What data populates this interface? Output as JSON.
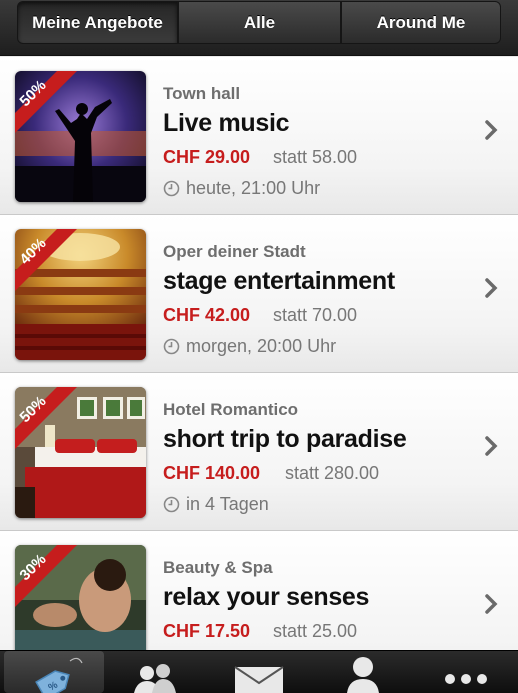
{
  "segments": [
    {
      "label": "Meine Angebote",
      "active": true
    },
    {
      "label": "Alle",
      "active": false
    },
    {
      "label": "Around Me",
      "active": false
    }
  ],
  "deals": [
    {
      "discount": "50%",
      "venue": "Town hall",
      "title": "Live music",
      "price": "CHF 29.00",
      "was": "statt 58.00",
      "when": "heute, 21:00 Uhr"
    },
    {
      "discount": "40%",
      "venue": "Oper deiner Stadt",
      "title": "stage entertainment",
      "price": "CHF 42.00",
      "was": "statt 70.00",
      "when": "morgen, 20:00 Uhr"
    },
    {
      "discount": "50%",
      "venue": "Hotel Romantico",
      "title": "short trip to paradise",
      "price": "CHF 140.00",
      "was": "statt 280.00",
      "when": "in 4 Tagen"
    },
    {
      "discount": "30%",
      "venue": "Beauty & Spa",
      "title": "relax your senses",
      "price": "CHF 17.50",
      "was": "statt 25.00",
      "when": ""
    }
  ],
  "tabs": [
    {
      "icon": "price-tag-icon",
      "active": true
    },
    {
      "icon": "people-icon",
      "active": false
    },
    {
      "icon": "envelope-icon",
      "active": false
    },
    {
      "icon": "person-icon",
      "active": false
    },
    {
      "icon": "more-icon",
      "active": false
    }
  ],
  "colors": {
    "price": "#c61d1d",
    "ribbon": "#c61d1d",
    "tabbar": "#1a1a1a"
  }
}
